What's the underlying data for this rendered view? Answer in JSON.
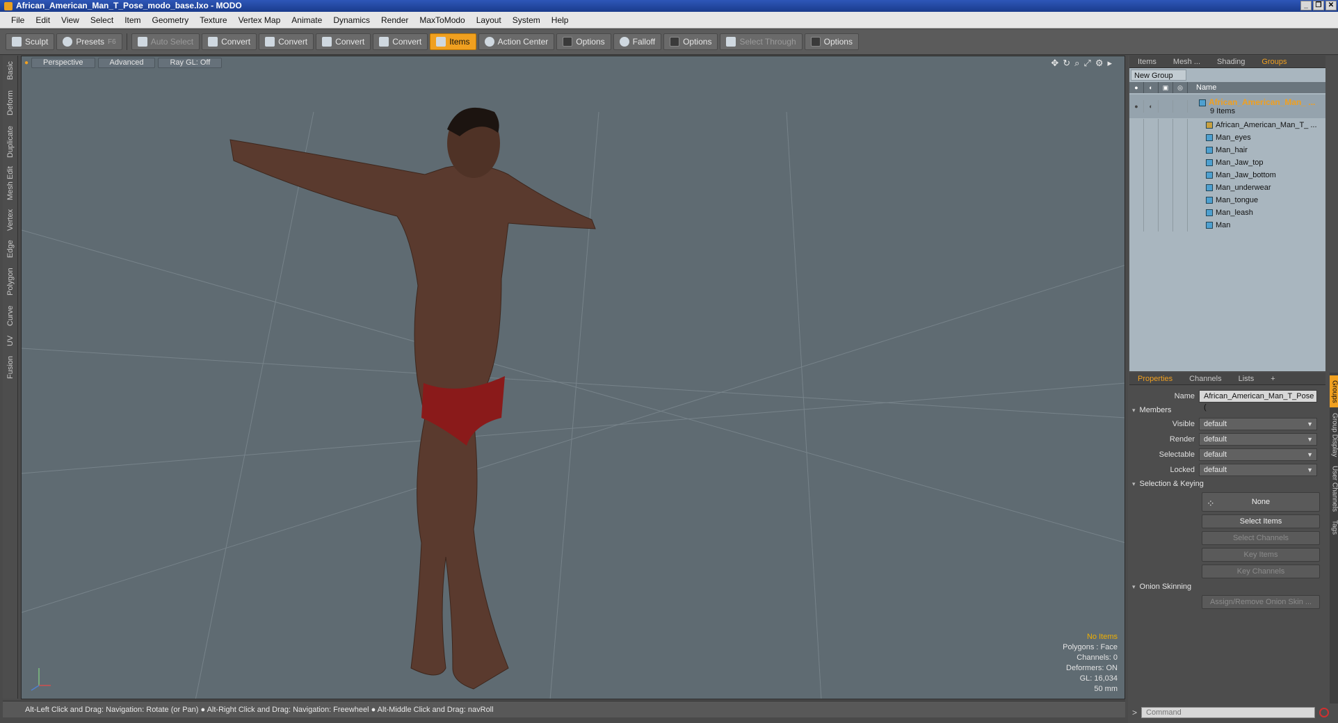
{
  "window": {
    "title": "African_American_Man_T_Pose_modo_base.lxo - MODO",
    "min": "_",
    "max": "❐",
    "close": "✕"
  },
  "menu": [
    "File",
    "Edit",
    "View",
    "Select",
    "Item",
    "Geometry",
    "Texture",
    "Vertex Map",
    "Animate",
    "Dynamics",
    "Render",
    "MaxToModo",
    "Layout",
    "System",
    "Help"
  ],
  "toolbar": {
    "sculpt": "Sculpt",
    "presets": "Presets",
    "presets_hint": "F6",
    "auto_select": "Auto Select",
    "convert1": "Convert",
    "convert2": "Convert",
    "convert3": "Convert",
    "convert4": "Convert",
    "items": "Items",
    "action_center": "Action Center",
    "options1": "Options",
    "falloff": "Falloff",
    "options2": "Options",
    "select_through": "Select Through",
    "options3": "Options"
  },
  "left_tabs": [
    "Basic",
    "Deform",
    "Duplicate",
    "Mesh Edit",
    "Vertex",
    "Edge",
    "Polygon",
    "Curve",
    "UV",
    "Fusion"
  ],
  "viewport": {
    "view_mode": "Perspective",
    "shading": "Advanced",
    "raygl": "Ray GL: Off",
    "info": {
      "selection": "No Items",
      "polygons": "Polygons : Face",
      "channels": "Channels: 0",
      "deformers": "Deformers: ON",
      "gl": "GL: 16,034",
      "lens": "50 mm"
    }
  },
  "statusbar": "Alt-Left Click and Drag: Navigation: Rotate (or Pan) ● Alt-Right Click and Drag: Navigation: Freewheel ● Alt-Middle Click and Drag: navRoll",
  "groups_panel": {
    "tabs": [
      "Items",
      "Mesh ...",
      "Shading",
      "Groups"
    ],
    "new_group": "New Group",
    "name_col": "Name",
    "group_name": "African_American_Man_ ...",
    "group_count": "9 Items",
    "items": [
      "African_American_Man_T_ ...",
      "Man_eyes",
      "Man_hair",
      "Man_Jaw_top",
      "Man_Jaw_bottom",
      "Man_underwear",
      "Man_tongue",
      "Man_leash",
      "Man"
    ]
  },
  "properties": {
    "tabs": [
      "Properties",
      "Channels",
      "Lists",
      "+"
    ],
    "name_label": "Name",
    "name_value": "African_American_Man_T_Pose (",
    "members": "Members",
    "visible_label": "Visible",
    "visible": "default",
    "render_label": "Render",
    "render": "default",
    "selectable_label": "Selectable",
    "selectable": "default",
    "locked_label": "Locked",
    "locked": "default",
    "sel_keying": "Selection & Keying",
    "none": "None",
    "select_items": "Select Items",
    "select_channels": "Select Channels",
    "key_items": "Key Items",
    "key_channels": "Key Channels",
    "onion": "Onion Skinning",
    "assign_onion": "Assign/Remove Onion Skin ...",
    "side_tabs": [
      "Groups",
      "Group Display",
      "User Channels",
      "Tags"
    ]
  },
  "command": {
    "prompt": ">",
    "placeholder": "Command"
  },
  "colors": {
    "accent": "#f0a020",
    "viewport_bg": "#5f6b72",
    "skin": "#5a3a2e",
    "underwear": "#8a1a1a"
  }
}
